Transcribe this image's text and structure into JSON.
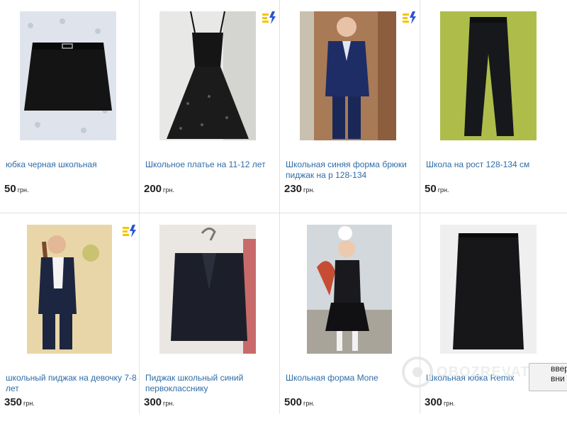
{
  "listings": [
    {
      "title": "юбка черная школьная",
      "price": "50",
      "currency": "грн.",
      "photo_icon": "skirt-photo",
      "badge": false
    },
    {
      "title": "Школьное платье на 11-12 лет",
      "price": "200",
      "currency": "грн.",
      "photo_icon": "dress-photo",
      "badge": true
    },
    {
      "title": "Школьная синяя форма брюки пиджак на р 128-134",
      "price": "230",
      "currency": "грн.",
      "photo_icon": "boy-suit-photo",
      "badge": true
    },
    {
      "title": "Школа на рост 128-134 см",
      "price": "50",
      "currency": "грн.",
      "photo_icon": "trousers-photo",
      "badge": false
    },
    {
      "title": "школьный пиджак на девочку 7-8 лет",
      "price": "350",
      "currency": "грн.",
      "photo_icon": "girl-jacket-photo",
      "badge": true
    },
    {
      "title": "Пиджак школьный синий первокласснику",
      "price": "300",
      "currency": "грн.",
      "photo_icon": "jacket-hanger-photo",
      "badge": false
    },
    {
      "title": "Школьная форма Mone",
      "price": "500",
      "currency": "грн.",
      "photo_icon": "girl-uniform-photo",
      "badge": false
    },
    {
      "title": "Школьная юбка Remix",
      "price": "300",
      "currency": "грн.",
      "photo_icon": "pencil-skirt-photo",
      "badge": false
    }
  ],
  "badge_icon": "lightning-badge-icon",
  "colors": {
    "link": "#2e6ca8",
    "badge_yellow": "#f5c400",
    "badge_blue": "#2a54d6",
    "border": "#e2e2e2"
  },
  "watermark": {
    "text": "OBOZREVATEL"
  },
  "popup": {
    "line1": "ввер",
    "line2": "вни"
  }
}
